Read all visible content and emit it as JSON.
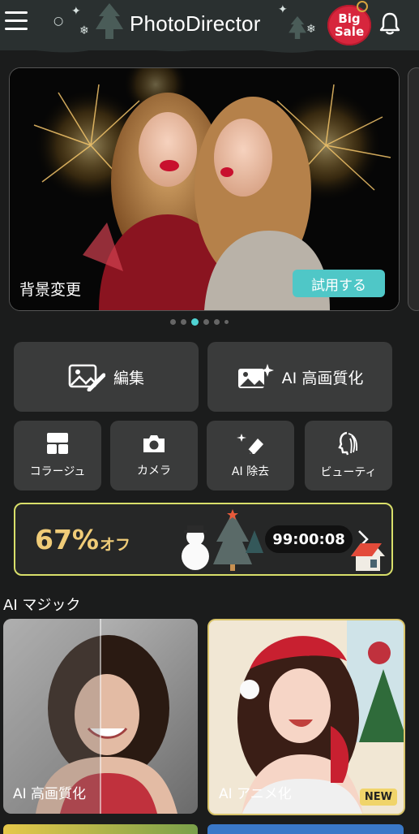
{
  "header": {
    "brand": "PhotoDirector",
    "sale_line1": "Big",
    "sale_line2": "Sale"
  },
  "banner": {
    "title": "背景変更",
    "button": "試用する",
    "page_count": 6,
    "active_page": 2
  },
  "tools": {
    "edit": "編集",
    "ai_enhance": "AI 高画質化",
    "collage": "コラージュ",
    "camera": "カメラ",
    "ai_remove": "AI 除去",
    "beauty": "ビューティ"
  },
  "promo": {
    "discount": "67%",
    "off": "オフ",
    "timer": "99:00:08"
  },
  "section": {
    "title": "AI マジック"
  },
  "cards": [
    {
      "label": "AI 高画質化"
    },
    {
      "label": "AI アニメ化",
      "badge": "NEW"
    }
  ],
  "colors": {
    "accent": "#4fc7c7",
    "promo_text": "#f0cc78",
    "promo_border": "#d9df6a",
    "sale_red": "#d7263d"
  }
}
